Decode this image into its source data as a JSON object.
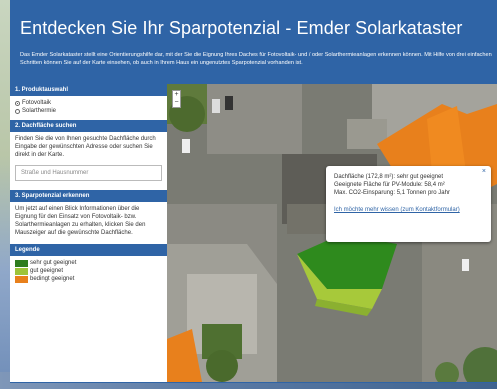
{
  "header": {
    "title": "Entdecken Sie Ihr Sparpotenzial - Emder Solarkataster",
    "intro": "Das Emder Solarkataster stellt eine Orientierungshilfe dar, mit der Sie die Eignung Ihres Daches für Fotovoltaik- und / oder Solarthermieanlagen erkennen können. Mit Hilfe von drei einfachen Schritten können Sie auf der Karte einsehen, ob auch in Ihrem Haus ein ungenutztes Sparpotenzial vorhanden ist."
  },
  "sidebar": {
    "section1": {
      "heading": "1. Produktauswahl",
      "options": [
        {
          "label": "Fotovoltaik",
          "selected": true
        },
        {
          "label": "Solarthermie",
          "selected": false
        }
      ]
    },
    "section2": {
      "heading": "2. Dachfläche suchen",
      "text": "Finden Sie die von Ihnen gesuchte Dachfläche durch Eingabe der gewünschten Adresse oder suchen Sie direkt in der Karte.",
      "search_placeholder": "Straße und Hausnummer"
    },
    "section3": {
      "heading": "3. Sparpotenzial erkennen",
      "text": "Um jetzt auf einen Blick Informationen über die Eignung für den Einsatz von Fotovoltaik- bzw. Solarthermieanlagen zu erhalten, klicken Sie den Mauszeiger auf die gewünschte Dachfläche."
    },
    "legend": {
      "heading": "Legende",
      "items": [
        {
          "label": "sehr gut geeignet",
          "color": "#2e7d1f"
        },
        {
          "label": "gut geeignet",
          "color": "#9dc43a"
        },
        {
          "label": "bedingt geeignet",
          "color": "#e8801c"
        }
      ]
    }
  },
  "map": {
    "zoom_in": "+",
    "zoom_out": "−",
    "popup": {
      "line1": "Dachfläche (172,8 m²): sehr gut geeignet",
      "line2": "Geeignete Fläche für PV-Module: 58,4 m²",
      "line3": "Max. CO2-Einsparung: 5,1 Tonnen pro Jahr",
      "link_text": "Ich möchte mehr wissen (zum Kontaktformular)",
      "close": "×"
    }
  },
  "colors": {
    "brand_blue": "#2f64a6",
    "very_good": "#2e7d1f",
    "good": "#9dc43a",
    "conditional": "#e8801c"
  }
}
